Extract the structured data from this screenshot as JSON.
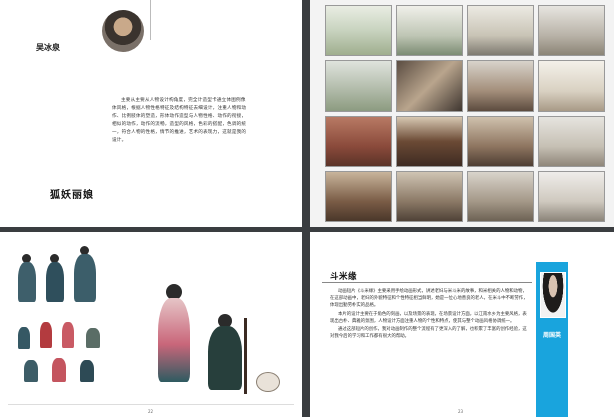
{
  "page1": {
    "author_name": "吴冰泉",
    "intro": "主要从主要从人物设计构角度，完全计造型卡通立体图例像体风格，根据人物性格特征及结构特征去细设计，注重人物和动作、比例肢体的塑造，形体动作造型与人物性格、动作的衔接，相似的动作，动作的流畅，造型的风格，色彩的搭配，色调的统一，符合人物的性格，情节的推进，艺术的表现力，这就是我的设计。",
    "work_title": "狐妖丽娘"
  },
  "page2": {
    "gallery_caption": ""
  },
  "page3": {
    "page_number": "22"
  },
  "page4": {
    "work_title": "斗米缘",
    "paragraphs": [
      "动画短片《斗米缘》主要采用手绘动画形式，讲述老妇与米斗米的故事，和米相关的人物和动物，在这部动画中，老妇的外貌特征和个性特征相当鲜明，她是一位心地善良的老人，在米斗中不断劳作，体现出勤劳朴实的品格。",
      "本片的设计主要在于角色的刻画，以及场景的表现，在场景设计方面，以江南水乡为主要风格，表现出古朴、典雅的氛围，人物设计方面注重人物的个性和特点，使其与整个动画风格协调统一。",
      "通过这部短片的创作，我对动画制作的整个流程有了更深入的了解，也积累了丰富的创作经验，这对我今后的学习和工作都有很大的帮助。"
    ],
    "author_name": "周国英",
    "page_number": "23"
  }
}
